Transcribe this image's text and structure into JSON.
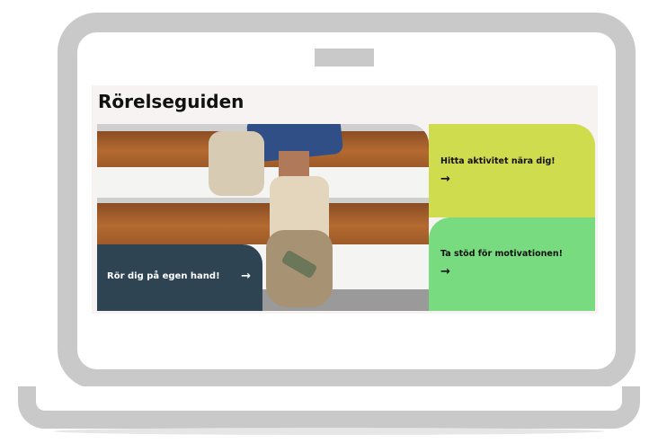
{
  "page": {
    "title": "Rörelseguiden"
  },
  "cards": {
    "dark": {
      "label": "Rör dig på egen hand!",
      "arrow": "→",
      "color": "#2e4452"
    },
    "yellow": {
      "label": "Hitta aktivitet nära dig!",
      "arrow": "→",
      "color": "#cfdc4e"
    },
    "green": {
      "label": "Ta stöd för motivationen!",
      "arrow": "→",
      "color": "#79db80"
    }
  },
  "hero_image": {
    "subject": "sneakers-climbing-stairs"
  },
  "frame": {
    "device": "laptop-outline",
    "color": "#c9c9c9"
  }
}
